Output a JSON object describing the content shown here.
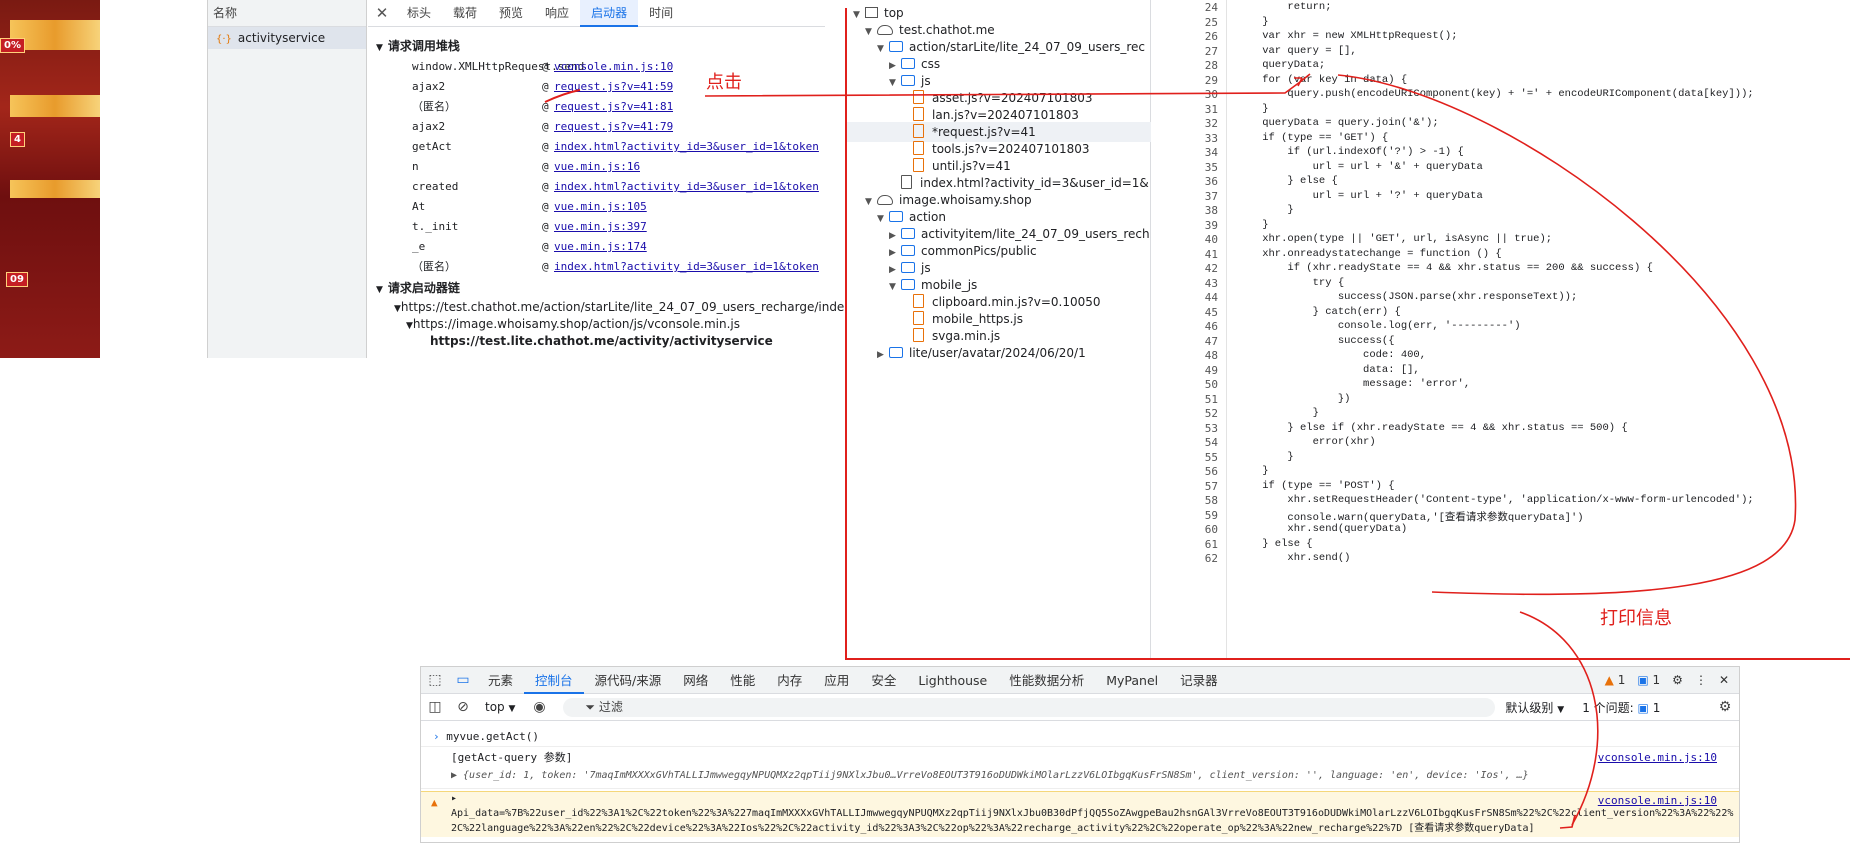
{
  "network": {
    "name_header": "名称",
    "request_name": "activityservice",
    "tabs": [
      "标头",
      "载荷",
      "预览",
      "响应",
      "启动器",
      "时间"
    ],
    "active_tab": "启动器",
    "call_stack_title": "请求调用堆栈",
    "call_stack": [
      {
        "fn": "window.XMLHttpRequest.send",
        "src": "vconsole.min.js:10"
      },
      {
        "fn": "ajax2",
        "src": "request.js?v=41:59"
      },
      {
        "fn": "（匿名）",
        "src": "request.js?v=41:81"
      },
      {
        "fn": "ajax2",
        "src": "request.js?v=41:79"
      },
      {
        "fn": "getAct",
        "src": "index.html?activity_id=3&user_id=1&token"
      },
      {
        "fn": "n",
        "src": "vue.min.js:16"
      },
      {
        "fn": "created",
        "src": "index.html?activity_id=3&user_id=1&token"
      },
      {
        "fn": "At",
        "src": "vue.min.js:105"
      },
      {
        "fn": "t._init",
        "src": "vue.min.js:397"
      },
      {
        "fn": "_e",
        "src": "vue.min.js:174"
      },
      {
        "fn": "（匿名）",
        "src": "index.html?activity_id=3&user_id=1&token"
      }
    ],
    "initiator_chain_title": "请求启动器链",
    "initiator_chain": [
      "https://test.chathot.me/action/starLite/lite_24_07_09_users_recharge/inde",
      "https://image.whoisamy.shop/action/js/vconsole.min.js",
      "https://test.lite.chathot.me/activity/activityservice"
    ],
    "game_badges": [
      "0%",
      "4",
      "09"
    ]
  },
  "sources": {
    "tree": [
      {
        "label": "top",
        "icon": "frame",
        "depth": 0,
        "open": true
      },
      {
        "label": "test.chathot.me",
        "icon": "cloud",
        "depth": 1,
        "open": true
      },
      {
        "label": "action/starLite/lite_24_07_09_users_rec",
        "icon": "folder",
        "depth": 2,
        "open": true
      },
      {
        "label": "css",
        "icon": "folder",
        "depth": 3,
        "open": false
      },
      {
        "label": "js",
        "icon": "folder",
        "depth": 3,
        "open": true
      },
      {
        "label": "asset.js?v=202407101803",
        "icon": "js",
        "depth": 4
      },
      {
        "label": "lan.js?v=202407101803",
        "icon": "js",
        "depth": 4
      },
      {
        "label": "*request.js?v=41",
        "icon": "js",
        "depth": 4,
        "selected": true
      },
      {
        "label": "tools.js?v=202407101803",
        "icon": "js",
        "depth": 4
      },
      {
        "label": "until.js?v=41",
        "icon": "js",
        "depth": 4
      },
      {
        "label": "index.html?activity_id=3&user_id=1&",
        "icon": "doc",
        "depth": 3
      },
      {
        "label": "image.whoisamy.shop",
        "icon": "cloud",
        "depth": 1,
        "open": true
      },
      {
        "label": "action",
        "icon": "folder",
        "depth": 2,
        "open": true
      },
      {
        "label": "activityitem/lite_24_07_09_users_rech",
        "icon": "folder",
        "depth": 3,
        "open": false
      },
      {
        "label": "commonPics/public",
        "icon": "folder",
        "depth": 3,
        "open": false
      },
      {
        "label": "js",
        "icon": "folder",
        "depth": 3,
        "open": false
      },
      {
        "label": "mobile_js",
        "icon": "folder",
        "depth": 3,
        "open": true
      },
      {
        "label": "clipboard.min.js?v=0.10050",
        "icon": "js",
        "depth": 4
      },
      {
        "label": "mobile_https.js",
        "icon": "js",
        "depth": 4
      },
      {
        "label": "svga.min.js",
        "icon": "js",
        "depth": 4
      },
      {
        "label": "lite/user/avatar/2024/06/20/1",
        "icon": "folder",
        "depth": 2,
        "open": false
      }
    ],
    "code": [
      {
        "n": "24",
        "t": "        return;"
      },
      {
        "n": "25",
        "t": "    }"
      },
      {
        "n": "26",
        "t": "    var xhr = new XMLHttpRequest();"
      },
      {
        "n": "27",
        "t": "    var query = [],"
      },
      {
        "n": "28",
        "t": "    queryData;"
      },
      {
        "n": "29",
        "t": "    for (var key in data) {"
      },
      {
        "n": "30",
        "t": "        query.push(encodeURIComponent(key) + '=' + encodeURIComponent(data[key]));"
      },
      {
        "n": "31",
        "t": "    }"
      },
      {
        "n": "32",
        "t": "    queryData = query.join('&');"
      },
      {
        "n": "33",
        "t": "    if (type == 'GET') {"
      },
      {
        "n": "34",
        "t": "        if (url.indexOf('?') > -1) {"
      },
      {
        "n": "35",
        "t": "            url = url + '&' + queryData"
      },
      {
        "n": "36",
        "t": "        } else {"
      },
      {
        "n": "37",
        "t": "            url = url + '?' + queryData"
      },
      {
        "n": "38",
        "t": "        }"
      },
      {
        "n": "39",
        "t": "    }"
      },
      {
        "n": "40",
        "t": "    xhr.open(type || 'GET', url, isAsync || true);"
      },
      {
        "n": "41",
        "t": "    xhr.onreadystatechange = function () {"
      },
      {
        "n": "42",
        "t": "        if (xhr.readyState == 4 && xhr.status == 200 && success) {"
      },
      {
        "n": "43",
        "t": "            try {"
      },
      {
        "n": "44",
        "t": "                success(JSON.parse(xhr.responseText));"
      },
      {
        "n": "45",
        "t": "            } catch(err) {"
      },
      {
        "n": "46",
        "t": "                console.log(err, '---------')"
      },
      {
        "n": "47",
        "t": "                success({"
      },
      {
        "n": "48",
        "t": "                    code: 400,"
      },
      {
        "n": "49",
        "t": "                    data: [],"
      },
      {
        "n": "50",
        "t": "                    message: 'error',"
      },
      {
        "n": "51",
        "t": "                })"
      },
      {
        "n": "52",
        "t": "            }"
      },
      {
        "n": "53",
        "t": "        } else if (xhr.readyState == 4 && xhr.status == 500) {"
      },
      {
        "n": "54",
        "t": "            error(xhr)"
      },
      {
        "n": "55",
        "t": "        }"
      },
      {
        "n": "56",
        "t": "    }"
      },
      {
        "n": "57",
        "t": "    if (type == 'POST') {"
      },
      {
        "n": "58",
        "t": "        xhr.setRequestHeader('Content-type', 'application/x-www-form-urlencoded');"
      },
      {
        "n": "59",
        "t": "        console.warn(queryData,'[查看请求参数queryData]')"
      },
      {
        "n": "60",
        "t": "        xhr.send(queryData)"
      },
      {
        "n": "61",
        "t": "    } else {"
      },
      {
        "n": "62",
        "t": "        xhr.send()"
      }
    ]
  },
  "console": {
    "tabs": [
      "元素",
      "控制台",
      "源代码/来源",
      "网络",
      "性能",
      "内存",
      "应用",
      "安全",
      "Lighthouse",
      "性能数据分析",
      "MyPanel",
      "记录器"
    ],
    "active_tab": "控制台",
    "warn_count": "1",
    "msg_count": "1",
    "context": "top",
    "filter_placeholder": "过滤",
    "level": "默认级别",
    "issues": "1 个问题:",
    "issues_count": "1",
    "lines": {
      "input": "myvue.getAct()",
      "log_title": "[getAct-query 参数]",
      "log_obj": "▶ {user_id: 1, token: '7maqImMXXXxGVhTALLIJmwwegqyNPUQMXz2qpTiij9NXlxJbu0…VrreVo8EOUT3T916oDUDWkiMOlarLzzV6LOIbgqKusFrSN8Sm', client_version: '', language: 'en', device: 'Ios', …}",
      "log_src": "vconsole.min.js:10",
      "warn_line1": "Api_data=%7B%22user_id%22%3A1%2C%22token%22%3A%227maqImMXXXxGVhTALLIJmwwegqyNPUQMXz2qpTiij9NXlxJbu0B30dPfjQQ5SoZAwgpeBau2hsnGAl3VrreVo8EOUT3T916oDUDWkiMOlarLzzV6LOIbgqKusFrSN8Sm%22%2C%22client_version%22%3A%22%22%",
      "warn_line2": "2C%22language%22%3A%22en%22%2C%22device%22%3A%22Ios%22%2C%22activity_id%22%3A3%2C%22op%22%3A%22recharge_activity%22%2C%22operate_op%22%3A%22new_recharge%22%7D",
      "warn_tag": "[查看请求参数queryData]",
      "warn_src": "vconsole.min.js:10"
    }
  },
  "annotations": {
    "click": "点击",
    "print": "打印信息"
  },
  "colors": {
    "annotation_red": "#e0201c",
    "link_blue": "#1a0dab",
    "active_blue": "#1a73e8"
  }
}
